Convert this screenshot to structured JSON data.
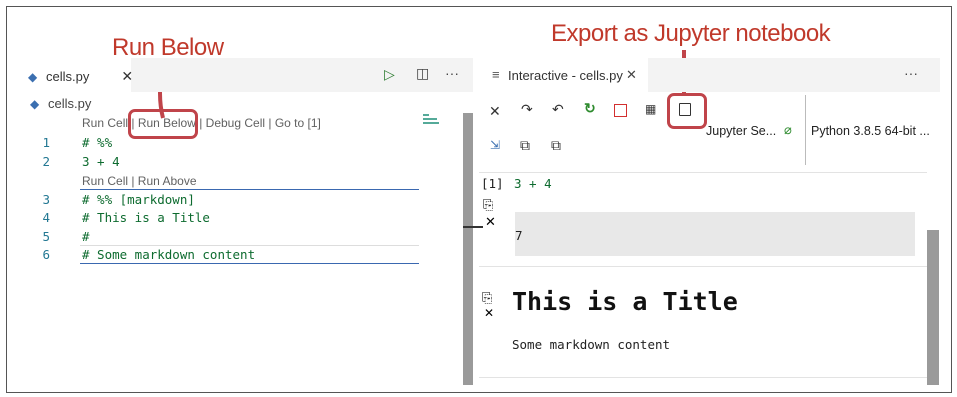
{
  "annotations": {
    "run_below": "Run Below",
    "export": "Export as Jupyter notebook"
  },
  "left": {
    "tab": {
      "label": "cells.py",
      "close": "✕"
    },
    "toolbar": {
      "run": "▷",
      "split": "◫",
      "more": "···"
    },
    "breadcrumb": "cells.py",
    "lens1": [
      "Run Cell",
      " | ",
      "Run Below",
      " | ",
      "Debug Cell",
      " | ",
      "Go to [1]"
    ],
    "lens2": "Run Cell | Run Above",
    "lines": [
      {
        "n": "1",
        "text": "# %%"
      },
      {
        "n": "2",
        "text": "3 + 4"
      },
      {
        "n": "3",
        "text": "# %% [markdown]"
      },
      {
        "n": "4",
        "text": "# This is a Title"
      },
      {
        "n": "5",
        "text": "#"
      },
      {
        "n": "6",
        "text": "# Some markdown content"
      }
    ]
  },
  "right": {
    "tab": {
      "icon": "≡",
      "label": "Interactive - cells.py",
      "close": "✕"
    },
    "more": "···",
    "kernel_short": "Jupyter Se...",
    "kernel": "Python 3.8.5 64-bit ...",
    "cell_in_label": "[1]",
    "cell_in_code": "3 + 4",
    "cell_out": "7",
    "md_title": "This is a Title",
    "md_body": "Some markdown content"
  }
}
